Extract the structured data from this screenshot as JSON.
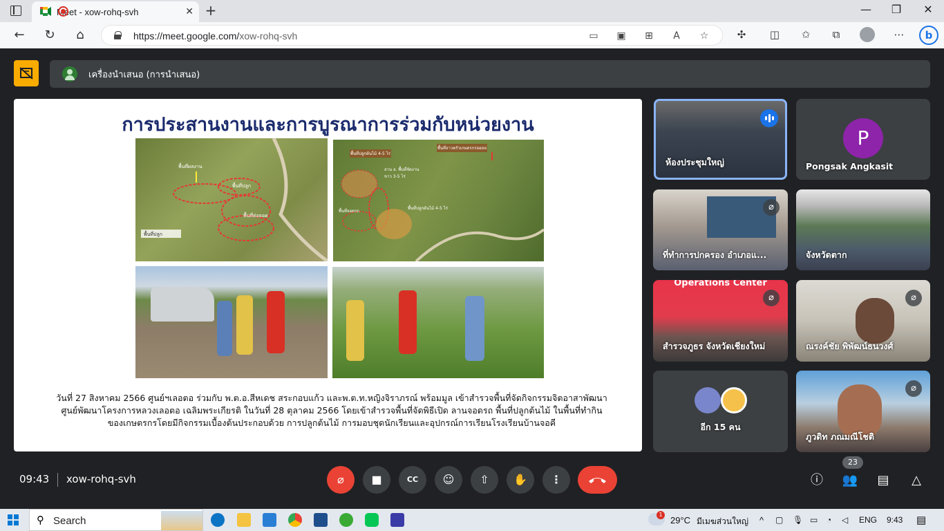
{
  "browser": {
    "tab_title": "Meet - xow-rohq-svh",
    "tab_close": "✕",
    "new_tab": "+",
    "url_host": "https://meet.google.com/",
    "url_path": "xow-rohq-svh",
    "window_controls": [
      "—",
      "❐",
      "✕"
    ]
  },
  "meet": {
    "presenter_label": "เครื่องนำเสนอ (การนำเสนอ)",
    "slide": {
      "title": "การประสานงานและการบูรณาการร่วมกับหน่วยงาน",
      "map_labels_left": [
        "พื้นที่ผลงาน",
        "พื้นที่ปลูก",
        "พื้นที่ปลูก",
        "พื้นที่ต่อยอด"
      ],
      "map_labels_right": [
        "พื้นที่ปลูกต้นไม้ 4-5 ไร่",
        "พื้นที่จาวครัวเกษตรกรลอลอ",
        "ลาน อ. พื้นที่จัดงาน ขาว 3-5 ไร่",
        "พื้นที่จอดรถ",
        "พื้นที่ปลูกต้นไม้ 4-5 ไร่"
      ],
      "caption": "วันที่ 27 สิงหาคม 2566 ศูนย์ฯเลอตอ ร่วมกับ พ.ต.อ.สีหเดช สระกอบแก้ว และพ.ต.ท.หญิงจิราภรณ์ พร้อมมูล เข้าสำรวจพื้นที่จัดกิจกรรมจิตอาสาพัฒนาศูนย์พัฒนาโครงการหลวงเลอตอ เฉลิมพระเกียรติ ในวันที่ 28 ตุลาคม 2566 โดยเข้าสำรวจพื้นที่จัดพิธีเปิด ลานจอดรถ พื้นที่ปลูกต้นไม้ ในพื้นที่ทำกินของเกษตรกรโดยมีกิจกรรมเบื้องต้นประกอบด้วย การปลูกต้นไม้ การมอบชุดนักเรียนและอุปกรณ์การเรียนโรงเรียนบ้านจอคี"
    },
    "participants": [
      {
        "name": "ห้องประชุมใหญ่",
        "speaking": true
      },
      {
        "name": "Pongsak Angkasit",
        "initial": "P",
        "avatar_color": "#8e24aa"
      },
      {
        "name": "ที่ทำการปกครอง อำเภอแ...",
        "muted": true
      },
      {
        "name": "จังหวัดตาก"
      },
      {
        "name": "สำรวจภูธร จังหวัดเชียงใหม่",
        "muted": true,
        "banner": "Operations Center"
      },
      {
        "name": "ณรงค์ชัย พิพัฒน์ธนวงศ์",
        "muted": true
      },
      {
        "name": "อีก 15 คน"
      },
      {
        "name": "ภูวดิท ภณมณีโชติ",
        "muted": true
      }
    ],
    "time": "09:43",
    "meeting_code": "xow-rohq-svh",
    "participant_count": "23"
  },
  "taskbar": {
    "search_label": "Search",
    "weather_temp": "29°C",
    "weather_text": "มีเมฆส่วนใหญ่",
    "weather_badge": "1",
    "language": "ENG",
    "clock": "9:43"
  }
}
